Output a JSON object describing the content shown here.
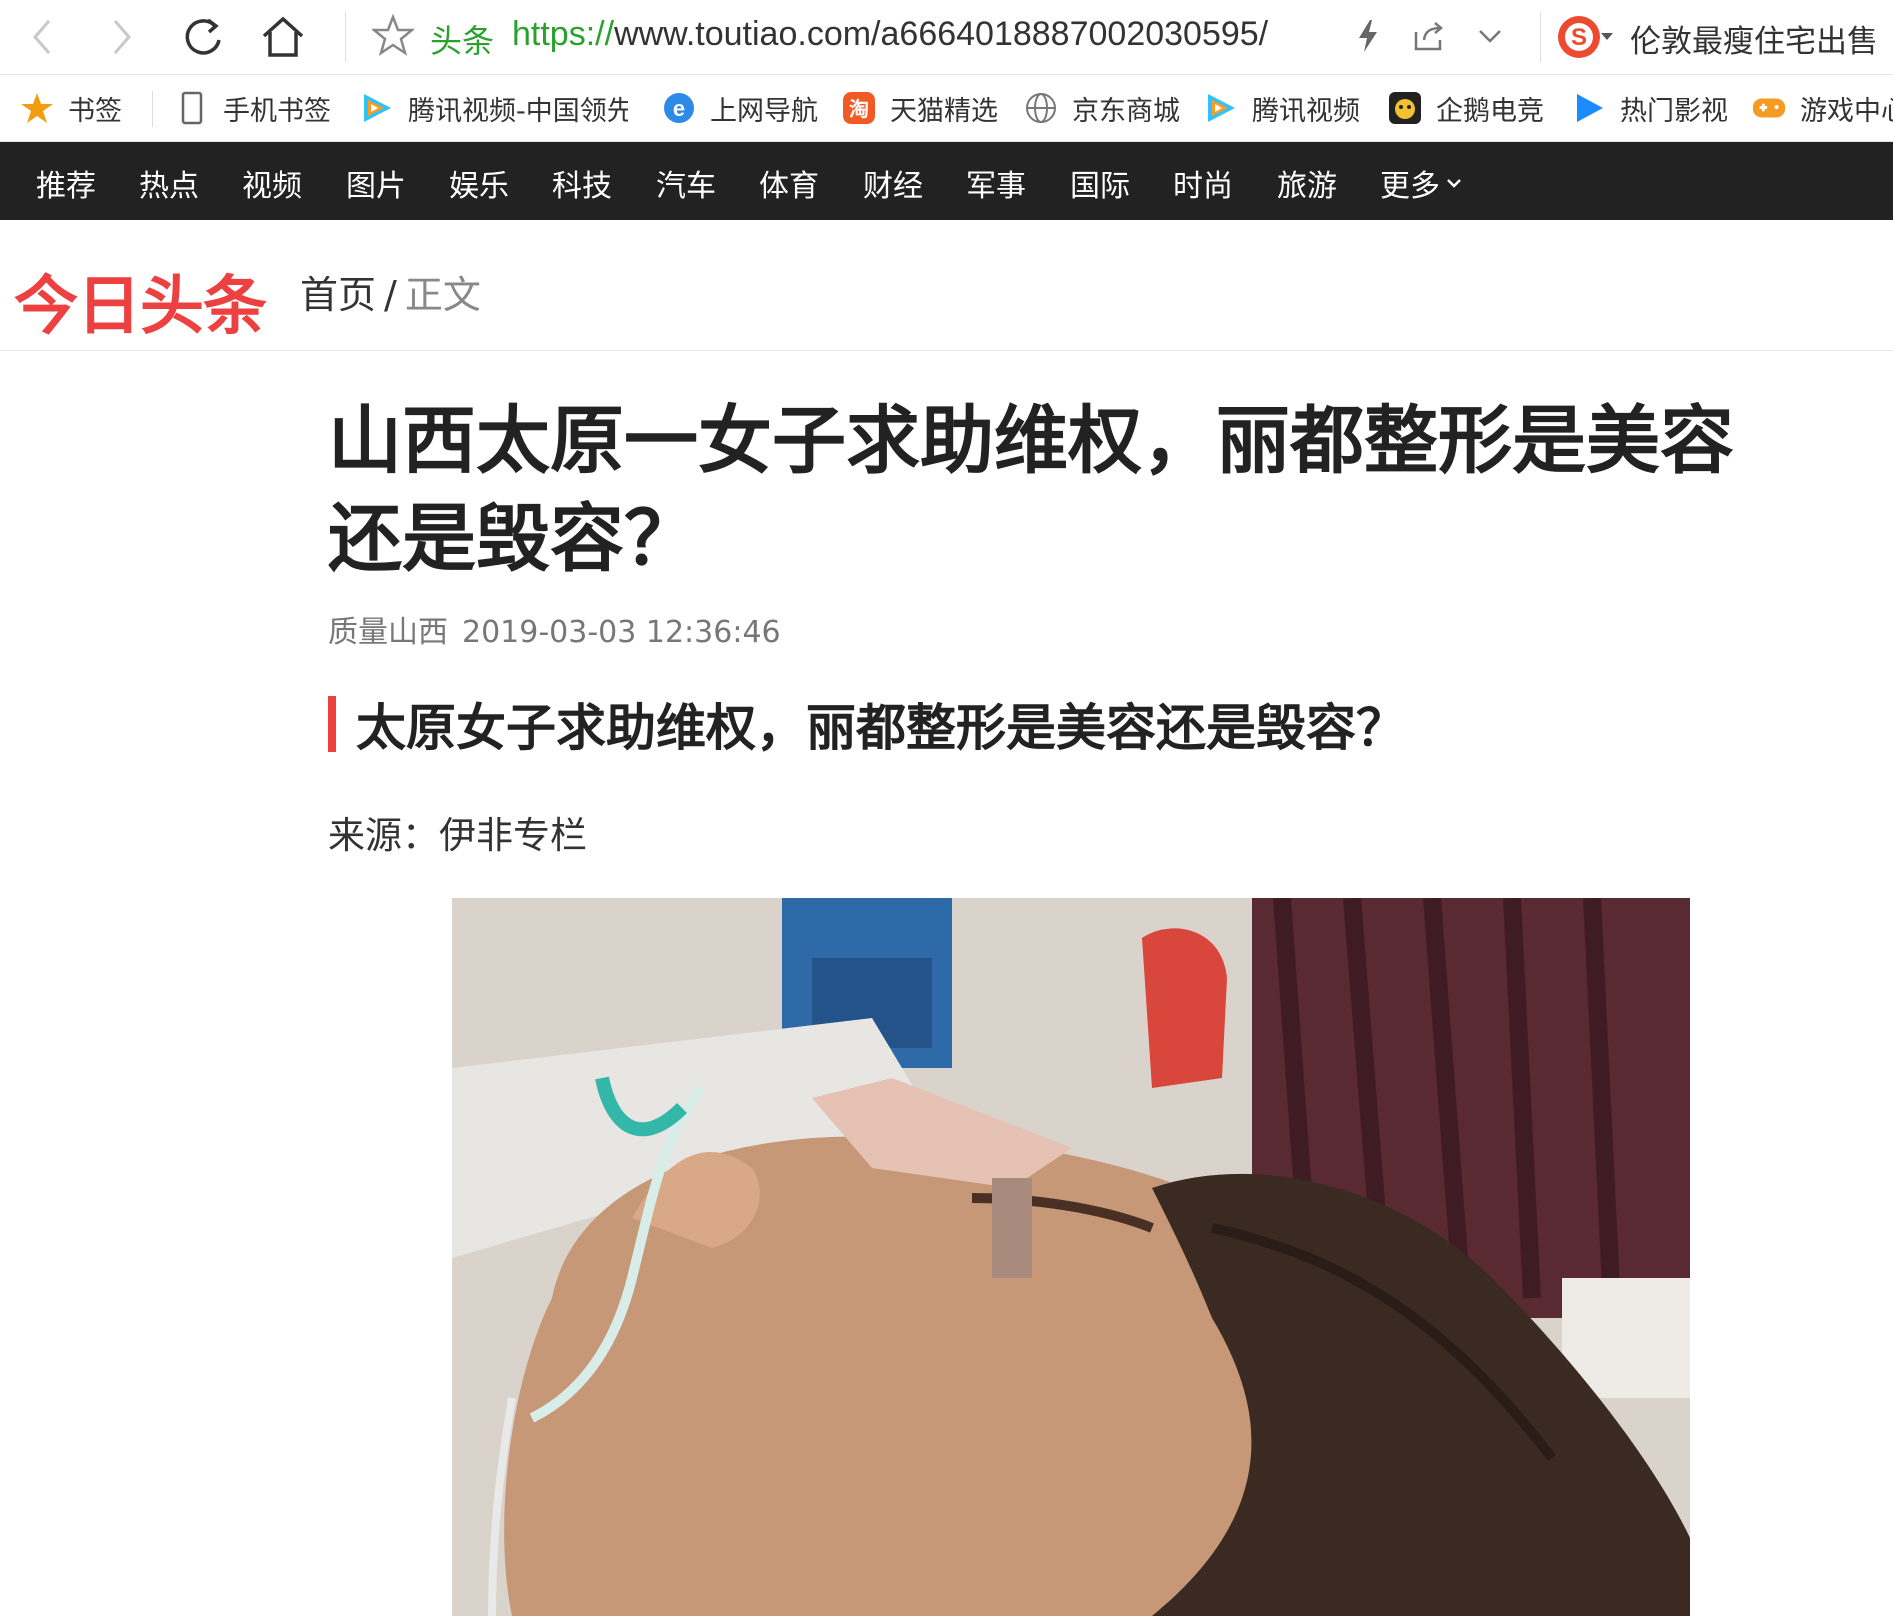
{
  "browser": {
    "site_tag": "头条",
    "url_scheme": "https://",
    "url_rest": "www.toutiao.com/a6664018887002030595/",
    "search_hint": "伦敦最瘦住宅出售"
  },
  "bookmarks": [
    {
      "label": "书签",
      "icon": "star-icon"
    },
    {
      "label": "手机书签",
      "icon": "phone-icon"
    },
    {
      "label": "腾讯视频-中国领先",
      "icon": "tencent-video-icon"
    },
    {
      "label": "上网导航",
      "icon": "ie-icon"
    },
    {
      "label": "天猫精选",
      "icon": "tmall-icon"
    },
    {
      "label": "京东商城",
      "icon": "globe-icon"
    },
    {
      "label": "腾讯视频",
      "icon": "tencent-video-icon"
    },
    {
      "label": "企鹅电竞",
      "icon": "penguin-esports-icon"
    },
    {
      "label": "热门影视",
      "icon": "play-icon"
    },
    {
      "label": "游戏中心",
      "icon": "gamepad-icon"
    }
  ],
  "channels": [
    "推荐",
    "热点",
    "视频",
    "图片",
    "娱乐",
    "科技",
    "汽车",
    "体育",
    "财经",
    "军事",
    "国际",
    "时尚",
    "旅游"
  ],
  "channel_more": "更多",
  "header": {
    "logo": "今日头条",
    "crumb_home": "首页",
    "crumb_sep": "/",
    "crumb_current": "正文"
  },
  "article": {
    "title": "山西太原一女子求助维权，丽都整形是美容还是毁容？",
    "source": "质量山西",
    "time": "2019-03-03 12:36:46",
    "subheading": "太原女子求助维权，丽都整形是美容还是毁容？",
    "source_line": "来源：伊非专栏"
  },
  "colors": {
    "accent_red": "#ed4040",
    "url_green": "#2aa12e",
    "nav_bg": "#222222"
  }
}
